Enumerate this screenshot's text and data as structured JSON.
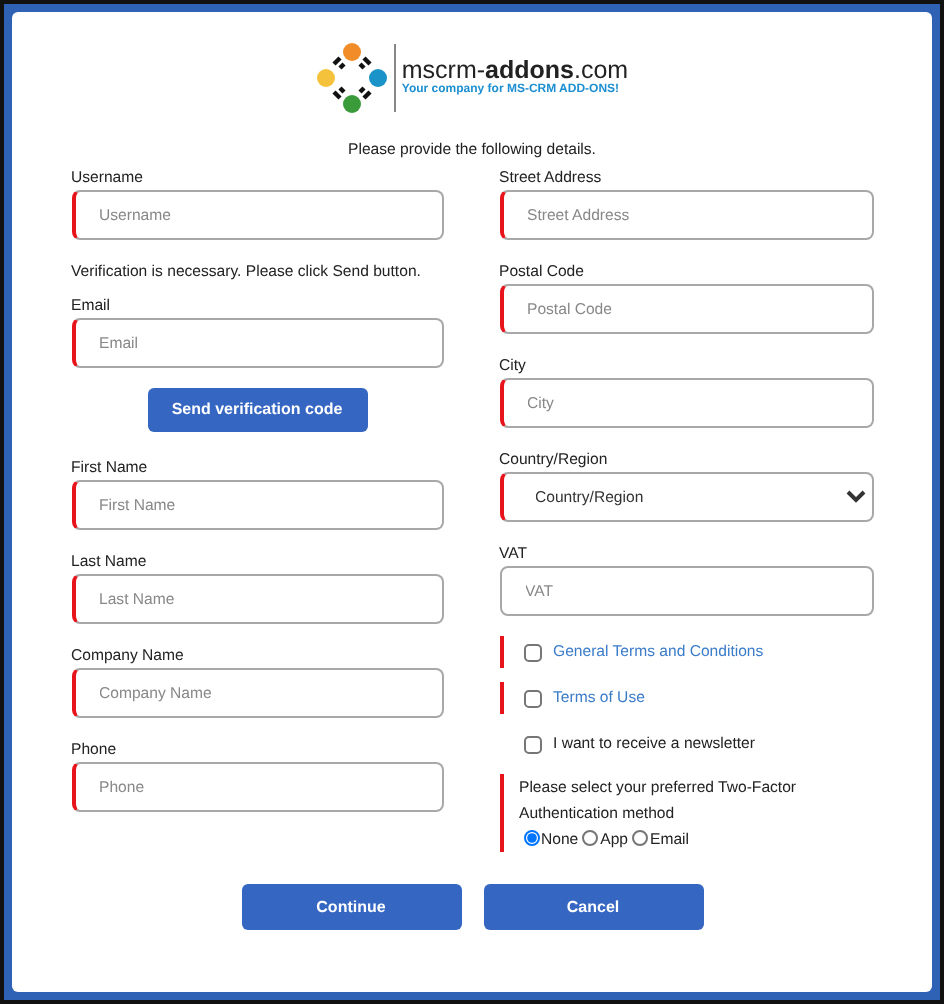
{
  "logo": {
    "brand": "mscrm-**addons**.com",
    "tagline": "Your company for MS-CRM ADD-ONS!"
  },
  "intro": "Please provide the following details.",
  "left_column": [
    {
      "kind": "field",
      "label": "Username",
      "placeholder": "Username",
      "required": true
    },
    {
      "kind": "note",
      "text": "Verification is necessary. Please click Send button."
    },
    {
      "kind": "field",
      "label": "Email",
      "placeholder": "Email",
      "required": true
    },
    {
      "kind": "button",
      "label": "Send verification code"
    },
    {
      "kind": "field",
      "label": "First Name",
      "placeholder": "First Name",
      "required": true
    },
    {
      "kind": "field",
      "label": "Last Name",
      "placeholder": "Last Name",
      "required": true
    },
    {
      "kind": "field",
      "label": "Company Name",
      "placeholder": "Company Name",
      "required": true
    },
    {
      "kind": "field",
      "label": "Phone",
      "placeholder": "Phone",
      "required": true
    }
  ],
  "right_column": [
    {
      "kind": "field",
      "label": "Street Address",
      "placeholder": "Street Address",
      "required": true
    },
    {
      "kind": "field",
      "label": "Postal Code",
      "placeholder": "Postal Code",
      "required": true
    },
    {
      "kind": "field",
      "label": "City",
      "placeholder": "City",
      "required": true
    },
    {
      "kind": "select",
      "label": "Country/Region",
      "value": "Country/Region",
      "required": true
    },
    {
      "kind": "field",
      "label": "VAT",
      "placeholder": "VAT",
      "required": false
    },
    {
      "kind": "checkbox",
      "label": "General Terms and Conditions",
      "link": true,
      "checked": false,
      "required": true
    },
    {
      "kind": "checkbox",
      "label": "Terms of Use",
      "link": true,
      "checked": false,
      "required": true
    },
    {
      "kind": "checkbox",
      "label": "I want to receive a newsletter",
      "link": false,
      "checked": false,
      "required": false
    },
    {
      "kind": "radio_group",
      "label": "Please select your preferred Two-Factor Authentication method",
      "required": true,
      "options": [
        {
          "label": "None",
          "selected": true
        },
        {
          "label": "App",
          "selected": false
        },
        {
          "label": "Email",
          "selected": false
        }
      ]
    }
  ],
  "buttons": [
    "Continue",
    "Cancel"
  ]
}
